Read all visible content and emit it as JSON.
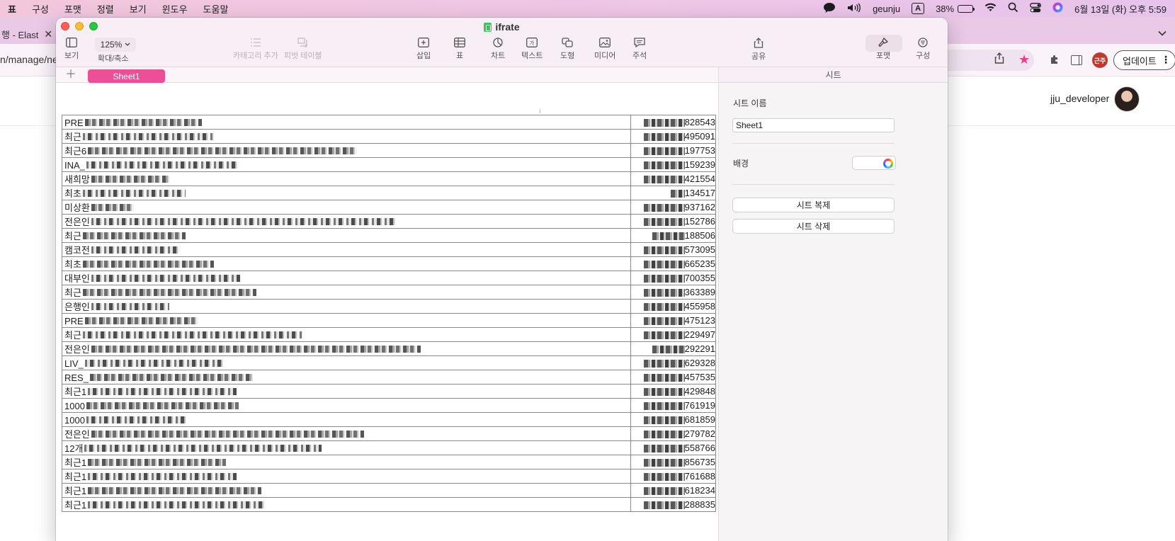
{
  "menubar": {
    "app_menu": "표",
    "items": [
      "구성",
      "포맷",
      "정렬",
      "보기",
      "윈도우",
      "도움말"
    ],
    "user": "geunju",
    "input_source": "A",
    "battery_percent": "38%",
    "battery_level": 0.38,
    "datetime": "6월 13일 (화) 오후 5:59"
  },
  "browser": {
    "tab_title": "행 - Elast",
    "url_fragment": "n/manage/ne",
    "profile_label": "근주",
    "update_button": "업데이트",
    "username": "jju_developer",
    "star_color": "#e83e8c"
  },
  "window": {
    "title": "ifrate",
    "accent_color": "#ec4f97"
  },
  "toolbar": {
    "view_label": "보기",
    "zoom_value": "125%",
    "zoom_label": "확대/축소",
    "add_category_label": "카테고리 추가",
    "pivot_table_label": "피벗 테이블",
    "insert_label": "삽입",
    "table_label": "표",
    "chart_label": "차트",
    "text_label": "텍스트",
    "shape_label": "도형",
    "media_label": "미디어",
    "comment_label": "주석",
    "share_label": "공유",
    "format_label": "포맷",
    "organize_label": "구성"
  },
  "sheets": {
    "add_icon": "plus-icon",
    "tabs": [
      "Sheet1"
    ]
  },
  "table": {
    "rows": [
      {
        "lead": "PRE",
        "num": "828543"
      },
      {
        "lead": "최근",
        "num": "495091"
      },
      {
        "lead": "최근6",
        "num": "197753"
      },
      {
        "lead": "INA_",
        "num": "159239"
      },
      {
        "lead": "새희망",
        "num": "421554"
      },
      {
        "lead": "최초",
        "num": "134517"
      },
      {
        "lead": "미상환",
        "num": "937162"
      },
      {
        "lead": "전은인",
        "num": "152786"
      },
      {
        "lead": "최근",
        "num": "188506"
      },
      {
        "lead": "캠코전",
        "num": "573095"
      },
      {
        "lead": "최초",
        "num": "665235"
      },
      {
        "lead": "대부인",
        "num": "700355"
      },
      {
        "lead": "최근",
        "num": "363389"
      },
      {
        "lead": "은행인",
        "num": "455958"
      },
      {
        "lead": "PRE",
        "num": "475123"
      },
      {
        "lead": "최근",
        "num": "229497"
      },
      {
        "lead": "전은인",
        "num": "292291"
      },
      {
        "lead": "LIV_",
        "num": "629328"
      },
      {
        "lead": "RES_",
        "num": "457535"
      },
      {
        "lead": "최근1",
        "num": "429848"
      },
      {
        "lead": "1000",
        "num": "761919"
      },
      {
        "lead": "1000",
        "num": "681859"
      },
      {
        "lead": "전은인",
        "num": "279782"
      },
      {
        "lead": "12개",
        "num": "558766"
      },
      {
        "lead": "최근1",
        "num": "856735"
      },
      {
        "lead": "최근1",
        "num": "761688"
      },
      {
        "lead": "최근1",
        "num": "618234"
      },
      {
        "lead": "최근1",
        "num": "288835"
      }
    ]
  },
  "inspector": {
    "header": "시트",
    "sheet_name_label": "시트 이름",
    "sheet_name_value": "Sheet1",
    "background_label": "배경",
    "duplicate_button": "시트 복제",
    "delete_button": "시트 삭제"
  }
}
